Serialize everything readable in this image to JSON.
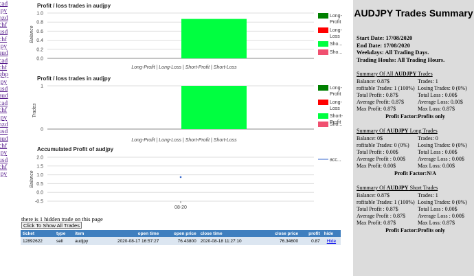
{
  "left_nav": {
    "items": [
      "cad",
      "jpy",
      "nzd",
      "chf",
      "usd",
      "chf",
      "jpy",
      "aud",
      "cad",
      "chf",
      "gbp",
      "jpy",
      "usd",
      "aud",
      "cad",
      "chf",
      "jpy",
      "nzd",
      "usd",
      "aud",
      "chf",
      "jpy",
      "usd",
      "chf",
      "jpy"
    ]
  },
  "charts": {
    "profit_loss_balance": {
      "title": "Profit / loss trades in audjpy",
      "ylabel": "Balance",
      "xlabel": "Long-Profit | Long-Loss | Short-Profit | Short-Loss",
      "y_ticks": [
        "1.0",
        "0.8",
        "0.6",
        "0.4",
        "0.2",
        "0.0"
      ],
      "legend": [
        "Long-Profit",
        "Long-Loss",
        "Sho...",
        "Sho..."
      ]
    },
    "profit_loss_trades": {
      "title": "Profit / loss trades in audjpy",
      "ylabel": "Trades",
      "xlabel": "Long-Profit | Long-Loss | Short-Profit | Short-Loss",
      "y_ticks": [
        "1",
        "0"
      ],
      "legend": [
        "Long-Profit",
        "Long-Loss",
        "Short-Profit",
        "Sho..."
      ]
    },
    "accumulated": {
      "title": "Accumulated Profit of audjpy",
      "ylabel": "Balance",
      "y_ticks": [
        "2.0",
        "1.5",
        "1.0",
        "0.5",
        "0.0",
        "-0.5"
      ],
      "x_ticks": [
        "08-20"
      ],
      "legend": [
        "acc..."
      ]
    }
  },
  "chart_data": [
    {
      "type": "bar",
      "title": "Profit / loss trades in audjpy",
      "xlabel": "Long-Profit | Long-Loss | Short-Profit | Short-Loss",
      "ylabel": "Balance",
      "ylim": [
        0,
        1.0
      ],
      "categories": [
        "Long-Profit",
        "Long-Loss",
        "Short-Profit",
        "Short-Loss"
      ],
      "values": [
        0,
        0,
        0.87,
        0
      ],
      "colors": [
        "#008000",
        "#ff0000",
        "#00ff40",
        "#f05070"
      ],
      "legend": "right"
    },
    {
      "type": "bar",
      "title": "Profit / loss trades in audjpy",
      "xlabel": "Long-Profit | Long-Loss | Short-Profit | Short-Loss",
      "ylabel": "Trades",
      "ylim": [
        0,
        1
      ],
      "categories": [
        "Long-Profit",
        "Long-Loss",
        "Short-Profit",
        "Short-Loss"
      ],
      "values": [
        0,
        0,
        1,
        0
      ],
      "colors": [
        "#008000",
        "#ff0000",
        "#00ff40",
        "#f05070"
      ],
      "legend": "right"
    },
    {
      "type": "scatter",
      "title": "Accumulated Profit of audjpy",
      "ylabel": "Balance",
      "ylim": [
        -0.5,
        2.0
      ],
      "x": [
        "08-20"
      ],
      "series": [
        {
          "name": "acc...",
          "values": [
            0.87
          ],
          "color": "#3366cc"
        }
      ],
      "legend": "right"
    }
  ],
  "hidden": {
    "note": "there is 1 hidden trade on this page",
    "button": "Click To Show All Trades"
  },
  "table": {
    "columns": [
      "ticket",
      "type",
      "item",
      "open time",
      "open price",
      "close time",
      "close price",
      "profit",
      "hide"
    ],
    "rows": [
      {
        "ticket": "12892622",
        "type": "sell",
        "item": "audjpy",
        "open_time": "2020-08-17 16:57:27",
        "open_price": "76.43800",
        "close_time": "2020-08-18 11:27:10",
        "close_price": "76.34600",
        "profit": "0.87",
        "hide": "Hide"
      }
    ]
  },
  "summary": {
    "title": "AUDJPY Trades Summary",
    "start": "Start Date: 17/08/2020",
    "end": "End Date: 17/08/2020",
    "weekdays": "Weekdays: All Trading Days.",
    "hours": "Trading Houhs: All Trading Hours.",
    "sections": [
      {
        "title_prefix": "Summary Of All ",
        "title_bold": "AUDJPY",
        "title_suffix": " Trades",
        "left": [
          "Balance: 0.87$",
          "rofitable Trades: 1 (100%)",
          "Total Profit : 0.87$",
          "Average Profit: 0.87$",
          "Max Profit: 0.87$"
        ],
        "right": [
          "Trades: 1",
          "Losing Trades: 0 (0%)",
          "Total Loss : 0.00$",
          "Average Loss: 0.00$",
          "Max Loss: 0.87$"
        ],
        "pf": "Profit Factor:Profits only"
      },
      {
        "title_prefix": "Summary Of ",
        "title_bold": "AUDJPY",
        "title_suffix": " Long Trades",
        "left": [
          "Balance: 0$",
          "rofitable Trades: 0 (0%)",
          "Total Profit : 0.00$",
          "Average Profit : 0.00$",
          "Max Profit: 0.00$"
        ],
        "right": [
          "Trades: 0",
          "Losing Trades: 0 (0%)",
          "Total Loss : 0.00$",
          "Average Loss : 0.00$",
          "Max Loss: 0.00$"
        ],
        "pf": "Profit Factor:N/A"
      },
      {
        "title_prefix": "Summary Of ",
        "title_bold": "AUDJPY",
        "title_suffix": " Short Trades",
        "left": [
          "Balance: 0.87$",
          "rofitable Trades: 1 (100%)",
          "Total Profit : 0.87$",
          "Average Profit : 0.87$",
          "Max Profit: 0.87$"
        ],
        "right": [
          "Trades: 1",
          "Losing Trades: 0 (0%)",
          "Total Loss : 0.00$",
          "Average Loss : 0.00$",
          "Max Loss: 0.87$"
        ],
        "pf": "Profit Factor:Profits only"
      }
    ]
  }
}
